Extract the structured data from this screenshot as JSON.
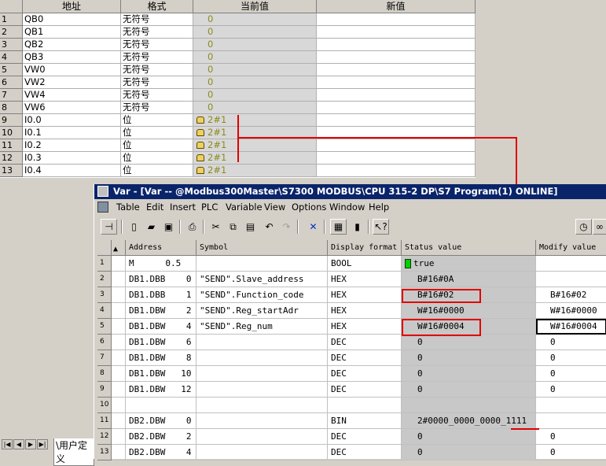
{
  "sheet": {
    "headers": [
      "地址",
      "格式",
      "当前值",
      "新值"
    ],
    "rows": [
      {
        "n": "1",
        "addr": "QB0",
        "fmt": "无符号",
        "cur": "0"
      },
      {
        "n": "2",
        "addr": "QB1",
        "fmt": "无符号",
        "cur": "0"
      },
      {
        "n": "3",
        "addr": "QB2",
        "fmt": "无符号",
        "cur": "0"
      },
      {
        "n": "4",
        "addr": "QB3",
        "fmt": "无符号",
        "cur": "0"
      },
      {
        "n": "5",
        "addr": "VW0",
        "fmt": "无符号",
        "cur": "0"
      },
      {
        "n": "6",
        "addr": "VW2",
        "fmt": "无符号",
        "cur": "0"
      },
      {
        "n": "7",
        "addr": "VW4",
        "fmt": "无符号",
        "cur": "0"
      },
      {
        "n": "8",
        "addr": "VW6",
        "fmt": "无符号",
        "cur": "0"
      },
      {
        "n": "9",
        "addr": "I0.0",
        "fmt": "位",
        "cur": "2#1"
      },
      {
        "n": "10",
        "addr": "I0.1",
        "fmt": "位",
        "cur": "2#1"
      },
      {
        "n": "11",
        "addr": "I0.2",
        "fmt": "位",
        "cur": "2#1"
      },
      {
        "n": "12",
        "addr": "I0.3",
        "fmt": "位",
        "cur": "2#1"
      },
      {
        "n": "13",
        "addr": "I0.4",
        "fmt": "位",
        "cur": "2#1"
      }
    ],
    "tab_label": "\\用户定义"
  },
  "var_window": {
    "title": "Var - [Var -- @Modbus300Master\\S7300 MODBUS\\CPU 315-2 DP\\S7 Program(1)  ONLINE]",
    "menu": [
      "Table",
      "Edit",
      "Insert",
      "PLC",
      "Variable",
      "View",
      "Options",
      "Window",
      "Help"
    ],
    "headers": [
      "Address",
      "Symbol",
      "Display format",
      "Status value",
      "Modify value"
    ],
    "rows": [
      {
        "n": "1",
        "addr": "M      0.5",
        "sym": "",
        "fmt": "BOOL",
        "status": "true",
        "modify": ""
      },
      {
        "n": "2",
        "addr": "DB1.DBB    0",
        "sym": "\"SEND\".Slave_address",
        "fmt": "HEX",
        "status": "B#16#0A",
        "modify": ""
      },
      {
        "n": "3",
        "addr": "DB1.DBB    1",
        "sym": "\"SEND\".Function_code",
        "fmt": "HEX",
        "status": "B#16#02",
        "modify": "B#16#02"
      },
      {
        "n": "4",
        "addr": "DB1.DBW    2",
        "sym": "\"SEND\".Reg_startAdr",
        "fmt": "HEX",
        "status": "W#16#0000",
        "modify": "W#16#0000"
      },
      {
        "n": "5",
        "addr": "DB1.DBW    4",
        "sym": "\"SEND\".Reg_num",
        "fmt": "HEX",
        "status": "W#16#0004",
        "modify": "W#16#0004"
      },
      {
        "n": "6",
        "addr": "DB1.DBW    6",
        "sym": "",
        "fmt": "DEC",
        "status": "0",
        "modify": "0"
      },
      {
        "n": "7",
        "addr": "DB1.DBW    8",
        "sym": "",
        "fmt": "DEC",
        "status": "0",
        "modify": "0"
      },
      {
        "n": "8",
        "addr": "DB1.DBW   10",
        "sym": "",
        "fmt": "DEC",
        "status": "0",
        "modify": "0"
      },
      {
        "n": "9",
        "addr": "DB1.DBW   12",
        "sym": "",
        "fmt": "DEC",
        "status": "0",
        "modify": "0"
      },
      {
        "n": "10",
        "addr": "",
        "sym": "",
        "fmt": "",
        "status": "",
        "modify": ""
      },
      {
        "n": "11",
        "addr": "DB2.DBW    0",
        "sym": "",
        "fmt": "BIN",
        "status": "2#0000_0000_0000_1111",
        "modify": ""
      },
      {
        "n": "12",
        "addr": "DB2.DBW    2",
        "sym": "",
        "fmt": "DEC",
        "status": "0",
        "modify": "0"
      },
      {
        "n": "13",
        "addr": "DB2.DBW    4",
        "sym": "",
        "fmt": "DEC",
        "status": "0",
        "modify": "0"
      }
    ]
  },
  "colors": {
    "annotation_red": "#e00000",
    "title_bar": "#0a246a",
    "status_column": "#c8c8c8"
  }
}
